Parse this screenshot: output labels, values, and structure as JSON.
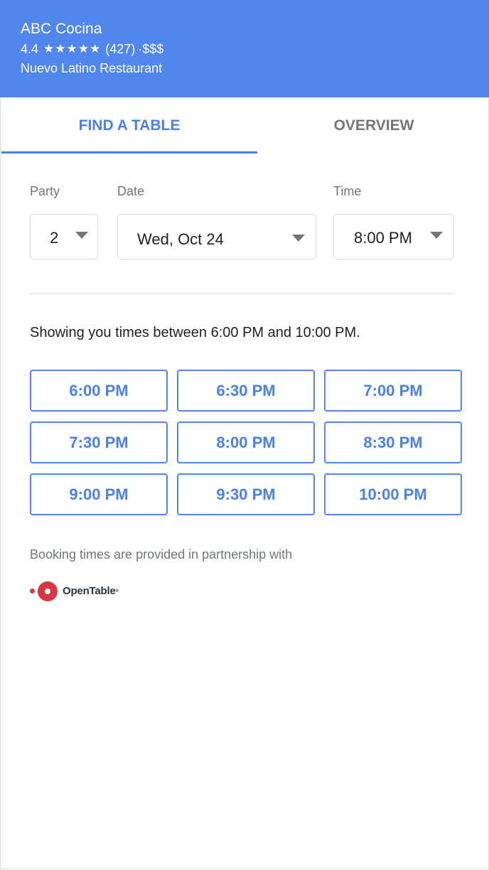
{
  "header": {
    "title": "ABC Cocina",
    "rating": "4.4",
    "stars": "★★★★★",
    "reviews": "(427)",
    "price": "·$$$",
    "category": "Nuevo Latino Restaurant",
    "background_color": "#5186ec"
  },
  "tabs": [
    {
      "label": "FIND A TABLE",
      "selected": true
    },
    {
      "label": "OVERVIEW",
      "selected": false
    }
  ],
  "form": {
    "party": {
      "label": "Party",
      "value": "2"
    },
    "date": {
      "label": "Date",
      "value": "Wed, Oct 24"
    },
    "time": {
      "label": "Time",
      "value": "8:00 PM"
    }
  },
  "showing_text": "Showing you times between 6:00 PM and 10:00 PM.",
  "time_slots": [
    "6:00 PM",
    "6:30 PM",
    "7:00 PM",
    "7:30 PM",
    "8:00 PM",
    "8:30 PM",
    "9:00 PM",
    "9:30 PM",
    "10:00 PM"
  ],
  "partner_text": "Booking times are provided in partnership with",
  "partner_logo": {
    "text": "OpenTable",
    "color": "#da3743"
  },
  "accent_color": "#4a80e8"
}
